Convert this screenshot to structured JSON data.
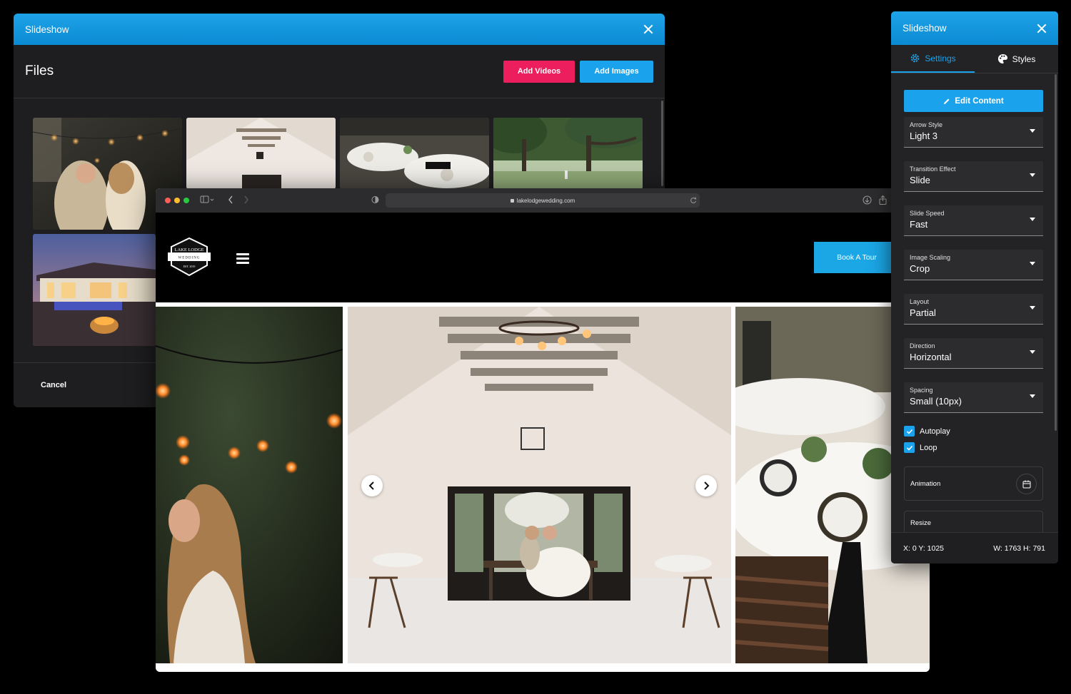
{
  "files_modal": {
    "title": "Slideshow",
    "heading": "Files",
    "add_videos_label": "Add Videos",
    "add_images_label": "Add Images",
    "cancel_label": "Cancel"
  },
  "browser": {
    "url": "lakelodgewedding.com",
    "logo_text_top": "LAKE LODGE",
    "logo_text_mid": "WEDDING",
    "logo_text_bottom": "EST. 2019",
    "book_label": "Book A Tour"
  },
  "settings": {
    "title": "Slideshow",
    "tabs": [
      {
        "label": "Settings"
      },
      {
        "label": "Styles"
      }
    ],
    "edit_label": "Edit Content",
    "fields": [
      {
        "label": "Arrow Style",
        "value": "Light 3"
      },
      {
        "label": "Transition Effect",
        "value": "Slide"
      },
      {
        "label": "Slide Speed",
        "value": "Fast"
      },
      {
        "label": "Image Scaling",
        "value": "Crop"
      },
      {
        "label": "Layout",
        "value": "Partial"
      },
      {
        "label": "Direction",
        "value": "Horizontal"
      },
      {
        "label": "Spacing",
        "value": "Small (10px)"
      }
    ],
    "checkboxes": [
      {
        "label": "Autoplay",
        "checked": true
      },
      {
        "label": "Loop",
        "checked": true
      }
    ],
    "animation_label": "Animation",
    "resize_label": "Resize",
    "position_text": "X: 0 Y: 1025",
    "size_text": "W: 1763 H: 791"
  },
  "colors": {
    "accent_blue": "#1aa3ec",
    "accent_pink": "#ec1e5e",
    "panel_bg": "#232325"
  }
}
